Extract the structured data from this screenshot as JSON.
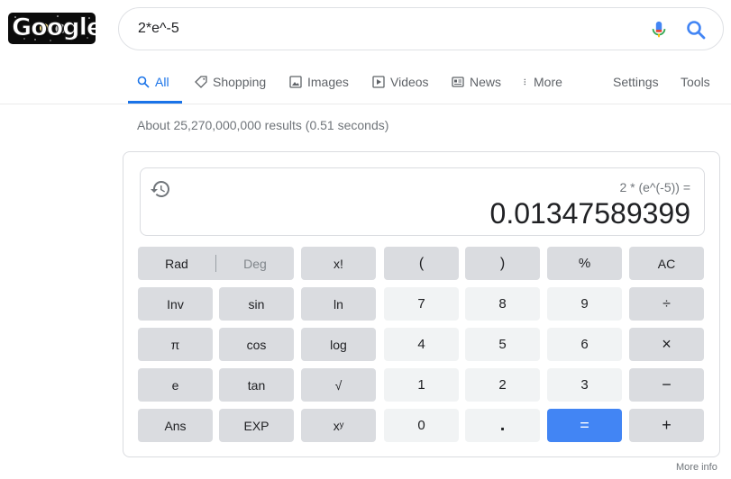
{
  "logo": {
    "text": "Google",
    "icon": "doodle-logo"
  },
  "search": {
    "value": "2*e^-5",
    "mic_icon": "mic-icon",
    "search_icon": "search-icon"
  },
  "tabs": {
    "all": "All",
    "shopping": "Shopping",
    "images": "Images",
    "videos": "Videos",
    "news": "News",
    "more": "More",
    "settings": "Settings",
    "tools": "Tools"
  },
  "results_stats": "About 25,270,000,000 results (0.51 seconds)",
  "calculator": {
    "expression": "2 * (e^(-5)) =",
    "result": "0.01347589399",
    "keys": {
      "rad": "Rad",
      "deg": "Deg",
      "fact": "x!",
      "lparen": "(",
      "rparen": ")",
      "percent": "%",
      "ac": "AC",
      "inv": "Inv",
      "sin": "sin",
      "ln": "ln",
      "seven": "7",
      "eight": "8",
      "nine": "9",
      "divide": "÷",
      "pi": "π",
      "cos": "cos",
      "log": "log",
      "four": "4",
      "five": "5",
      "six": "6",
      "multiply": "×",
      "e": "e",
      "tan": "tan",
      "sqrt": "√",
      "one": "1",
      "two": "2",
      "three": "3",
      "minus": "−",
      "ans": "Ans",
      "exp": "EXP",
      "pow": "xʸ",
      "zero": "0",
      "dot": ".",
      "equals": "=",
      "plus": "+"
    }
  },
  "more_info": "More info",
  "colors": {
    "accent": "#1a73e8",
    "equals_button": "#4285f4",
    "fn_key": "#dadce0",
    "num_key": "#f1f3f4"
  }
}
